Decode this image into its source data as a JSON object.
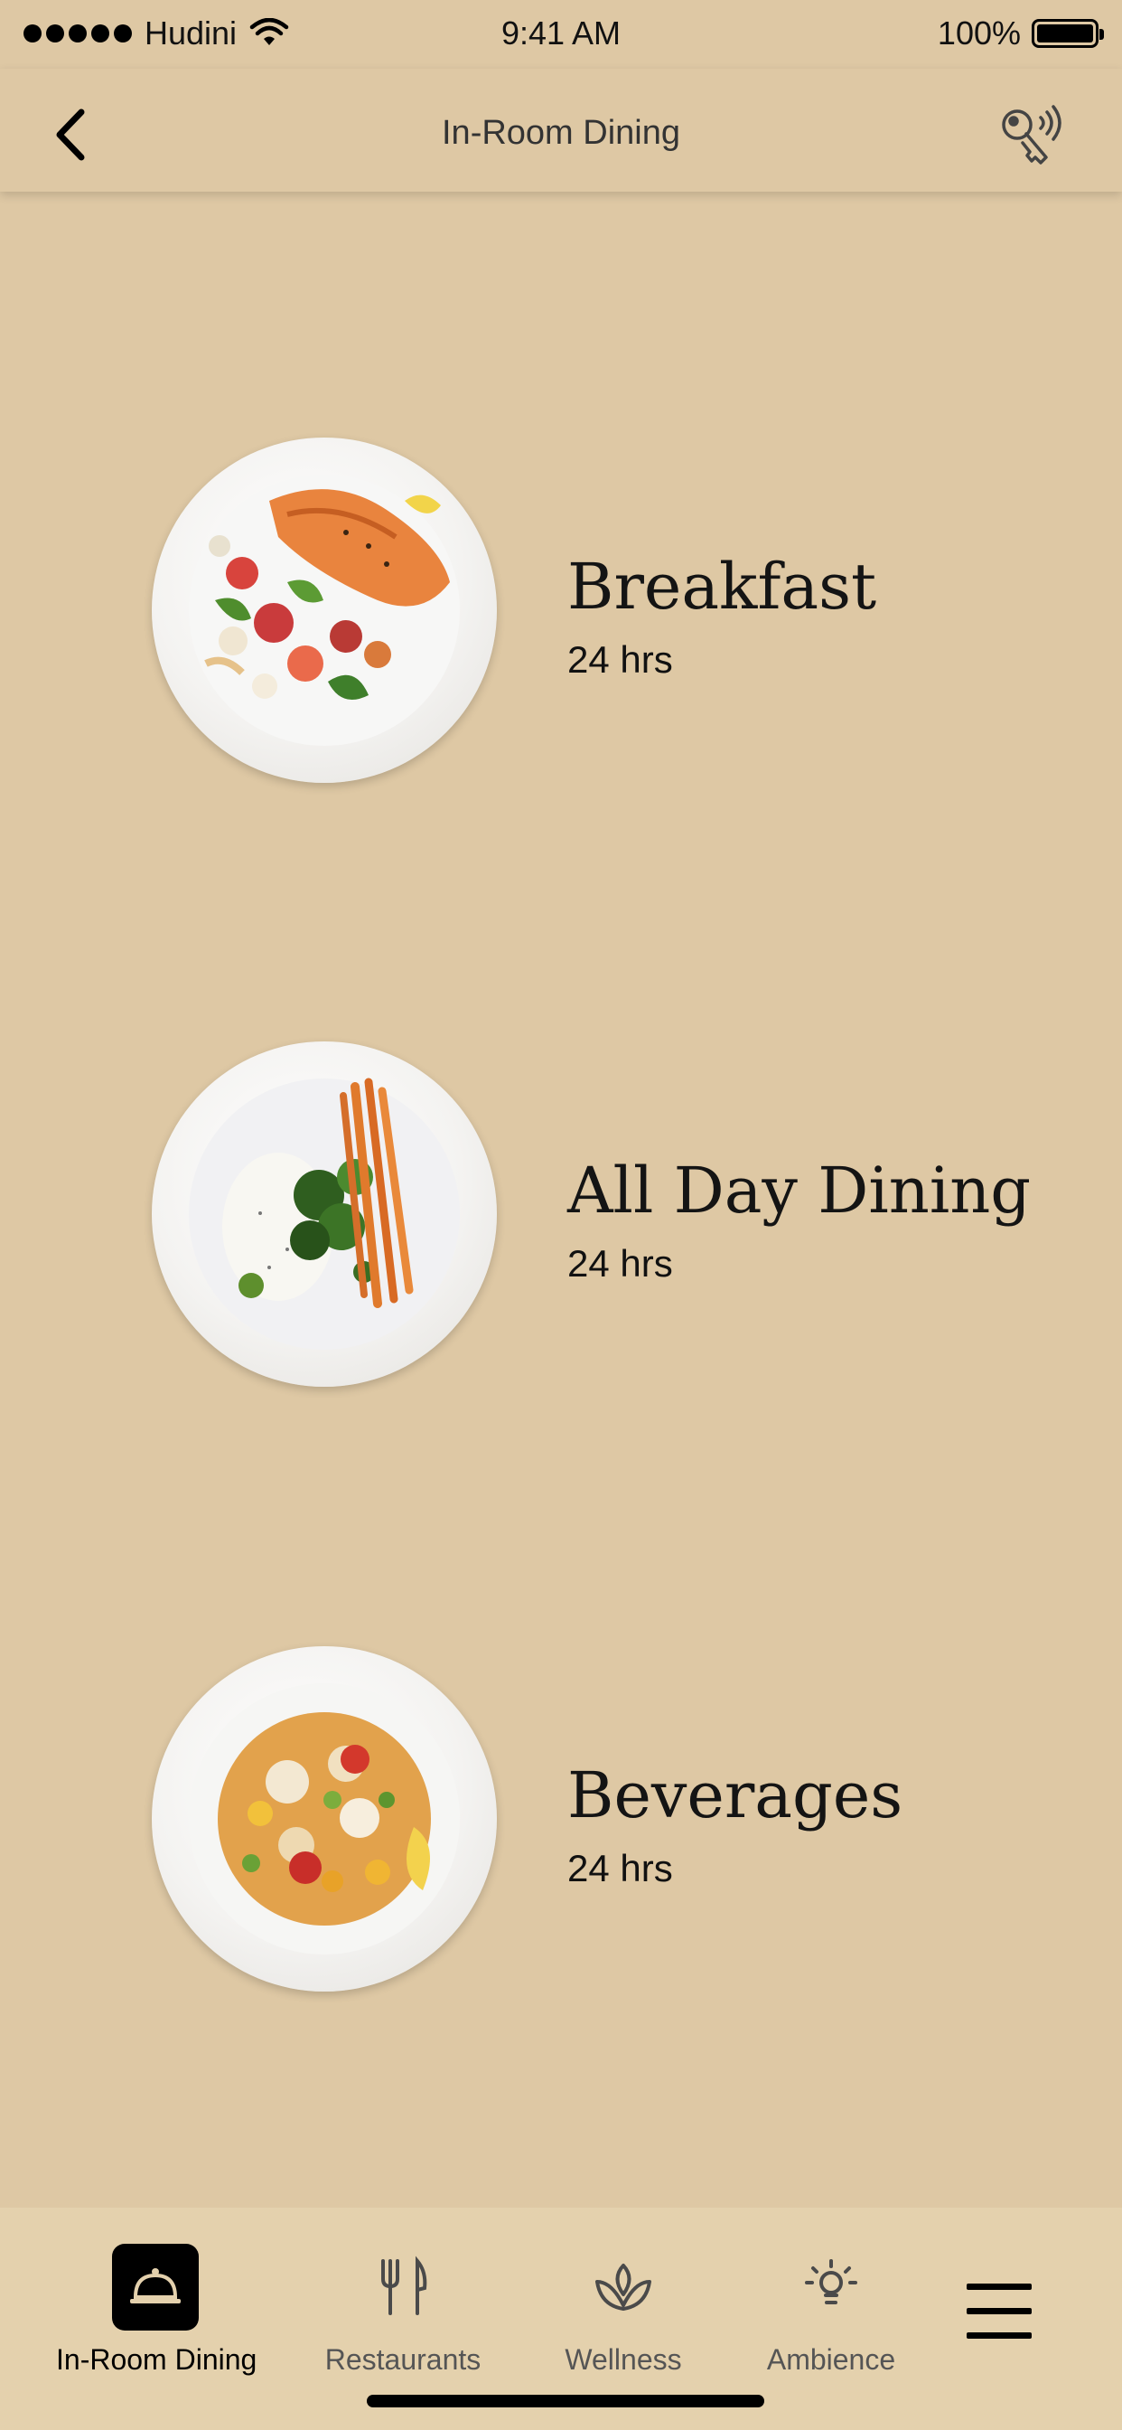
{
  "status_bar": {
    "carrier": "Hudini",
    "time": "9:41 AM",
    "battery": "100%"
  },
  "nav": {
    "title": "In-Room Dining",
    "back_icon": "chevron-left-icon",
    "right_icon": "key-wireless-icon"
  },
  "menu": [
    {
      "title": "Breakfast",
      "hours": "24 hrs",
      "image": "salmon-with-roasted-vegetables-plate"
    },
    {
      "title": "All Day Dining",
      "hours": "24 hrs",
      "image": "greens-carrots-puree-plate"
    },
    {
      "title": "Beverages",
      "hours": "24 hrs",
      "image": "salad-with-tomatoes-and-lemon-plate"
    }
  ],
  "tabs": [
    {
      "label": "In-Room Dining",
      "icon": "cloche-icon",
      "active": true
    },
    {
      "label": "Restaurants",
      "icon": "fork-knife-icon",
      "active": false
    },
    {
      "label": "Wellness",
      "icon": "lotus-icon",
      "active": false
    },
    {
      "label": "Ambience",
      "icon": "light-bulb-icon",
      "active": false
    },
    {
      "label": "",
      "icon": "hamburger-menu-icon",
      "active": false
    }
  ],
  "colors": {
    "background": "#dec8a4",
    "tab_bar": "#e4d1ad",
    "active_tab": "#000000"
  }
}
